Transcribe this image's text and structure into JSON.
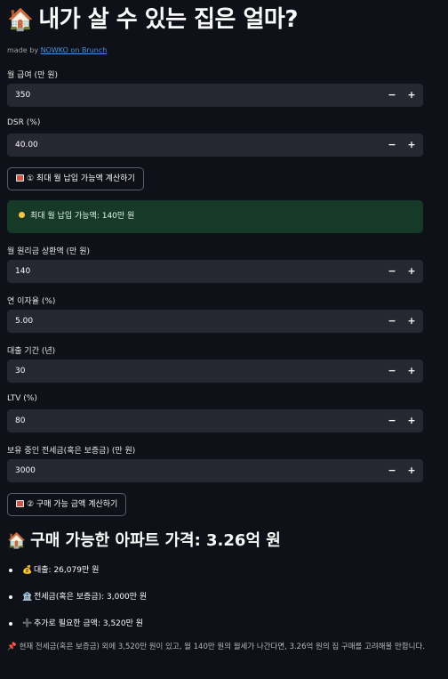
{
  "title": {
    "icon": "🏠",
    "text": "내가 살 수 있는 집은 얼마?"
  },
  "made_by": {
    "prefix": "made by ",
    "link": "NOWKO on Brunch"
  },
  "inputs": {
    "salary": {
      "label": "월 급여 (만 원)",
      "value": "350"
    },
    "dsr": {
      "label": "DSR (%)",
      "value": "40.00"
    },
    "monthly_payment": {
      "label": "월 원리금 상환액 (만 원)",
      "value": "140"
    },
    "interest": {
      "label": "연 이자율 (%)",
      "value": "5.00"
    },
    "term": {
      "label": "대출 기간 (년)",
      "value": "30"
    },
    "ltv": {
      "label": "LTV (%)",
      "value": "80"
    },
    "deposit": {
      "label": "보유 중인 전세금(혹은 보증금) (만 원)",
      "value": "3000"
    }
  },
  "stepper": {
    "minus": "−",
    "plus": "+"
  },
  "buttons": {
    "calc_max_payment": "① 최대 월 납입 가능액 계산하기",
    "calc_price": "② 구매 가능 금액 계산하기"
  },
  "alert": {
    "icon": "lightbulb-icon",
    "text": "최대 월 납입 가능액: 140만 원"
  },
  "result": {
    "icon": "🏠",
    "heading": "구매 가능한 아파트 가격: 3.26억 원",
    "items": [
      {
        "icon": "💰",
        "icon_name": "money-bag-icon",
        "text": "대출: 26,079만 원"
      },
      {
        "icon": "🏦",
        "icon_name": "bank-icon",
        "text": "전세금(혹은 보증금): 3,000만 원"
      },
      {
        "icon": "➕",
        "icon_name": "plus-icon",
        "text": "추가로 필요한 금액: 3,520만 원"
      }
    ]
  },
  "note": {
    "icon": "📌",
    "text": "현재 전세금(혹은 보증금) 외에 3,520만 원이 있고, 월 140만 원의 월세가 나간다면, 3.26억 원의 집 구매를 고려해볼 만합니다."
  },
  "colors": {
    "background": "#0e1117",
    "input_bg": "#262730",
    "success_bg": "#173928",
    "link": "#4a90e2"
  }
}
